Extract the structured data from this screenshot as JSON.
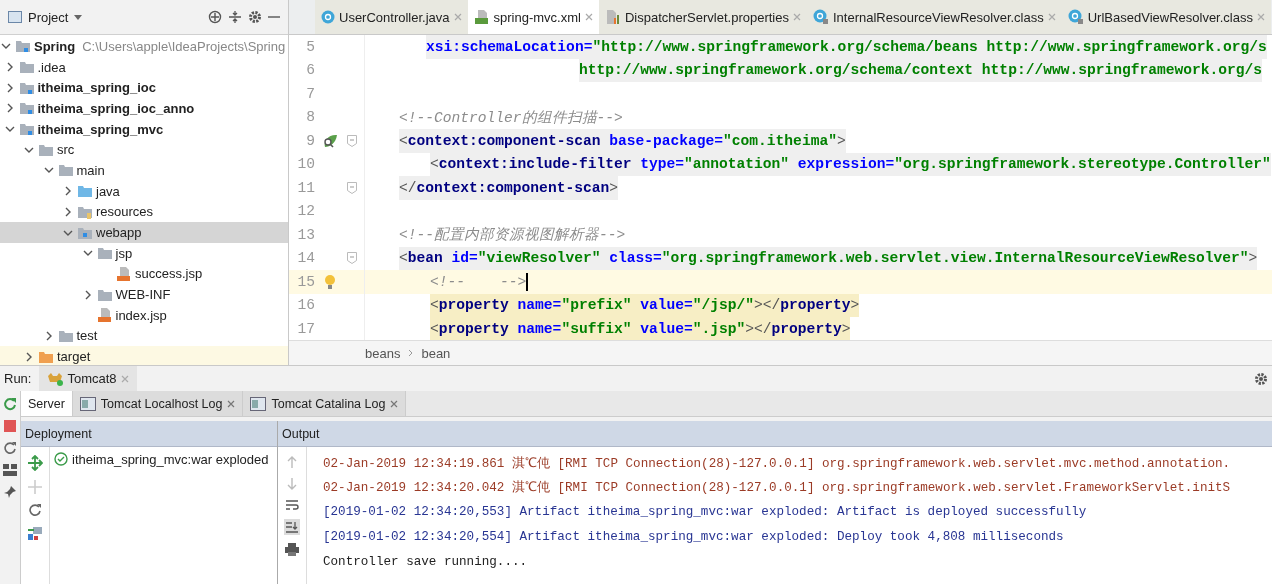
{
  "project_panel": {
    "title": "Project",
    "tree": [
      {
        "label": "Spring",
        "path": "C:\\Users\\apple\\IdeaProjects\\Spring",
        "kind": "module",
        "bold": true,
        "expanded": true,
        "selected": false,
        "children": [
          {
            "label": ".idea",
            "kind": "folder",
            "bold": false,
            "expanded": false,
            "selected": false
          },
          {
            "label": "itheima_spring_ioc",
            "kind": "module",
            "bold": true,
            "expanded": false,
            "selected": false
          },
          {
            "label": "itheima_spring_ioc_anno",
            "kind": "module",
            "bold": true,
            "expanded": false,
            "selected": false
          },
          {
            "label": "itheima_spring_mvc",
            "kind": "module",
            "bold": true,
            "expanded": true,
            "selected": false,
            "children": [
              {
                "label": "src",
                "kind": "folder",
                "bold": false,
                "expanded": true,
                "selected": false,
                "children": [
                  {
                    "label": "main",
                    "kind": "folder",
                    "bold": false,
                    "expanded": true,
                    "selected": false,
                    "children": [
                      {
                        "label": "java",
                        "kind": "source",
                        "bold": false,
                        "expanded": false,
                        "selected": false
                      },
                      {
                        "label": "resources",
                        "kind": "resources",
                        "bold": false,
                        "expanded": false,
                        "selected": false
                      },
                      {
                        "label": "webapp",
                        "kind": "web",
                        "bold": false,
                        "expanded": true,
                        "selected": true,
                        "children": [
                          {
                            "label": "jsp",
                            "kind": "folder",
                            "bold": false,
                            "expanded": true,
                            "selected": false,
                            "children": [
                              {
                                "label": "success.jsp",
                                "kind": "jsp",
                                "bold": false,
                                "selected": false
                              }
                            ]
                          },
                          {
                            "label": "WEB-INF",
                            "kind": "folder",
                            "bold": false,
                            "expanded": false,
                            "selected": false
                          },
                          {
                            "label": "index.jsp",
                            "kind": "jsp",
                            "bold": false,
                            "selected": false
                          }
                        ]
                      }
                    ]
                  },
                  {
                    "label": "test",
                    "kind": "folder",
                    "bold": false,
                    "expanded": false,
                    "selected": false
                  }
                ]
              },
              {
                "label": "target",
                "kind": "excluded",
                "bold": false,
                "expanded": false,
                "selected": false
              }
            ]
          }
        ]
      }
    ]
  },
  "editor": {
    "tabs": [
      {
        "label": "UserController.java",
        "kind": "java",
        "selected": false
      },
      {
        "label": "spring-mvc.xml",
        "kind": "xml",
        "selected": true
      },
      {
        "label": "DispatcherServlet.properties",
        "kind": "properties",
        "selected": false
      },
      {
        "label": "InternalResourceViewResolver.class",
        "kind": "class",
        "selected": false
      },
      {
        "label": "UrlBasedViewResolver.class",
        "kind": "class",
        "selected": false
      }
    ],
    "lines": [
      {
        "number": "5",
        "kind": "attribute",
        "highlighted": true,
        "matched": false,
        "current": false,
        "fold": false,
        "bean_icon": false,
        "bulb_icon": false,
        "tokens": [
          {
            "kind": "attr",
            "text": "xsi:schemaLocation="
          },
          {
            "kind": "value",
            "text": "\"http://www.springframework.org/schema/beans http://www.springframework.org/s"
          }
        ]
      },
      {
        "number": "6",
        "kind": "continuation",
        "highlighted": true,
        "matched": false,
        "current": false,
        "fold": false,
        "bean_icon": false,
        "bulb_icon": false,
        "tokens": [
          {
            "kind": "value",
            "text": "http://www.springframework.org/schema/context http://www.springframework.org/s"
          }
        ]
      },
      {
        "number": "7",
        "kind": "blank",
        "current": false,
        "fold": false,
        "bean_icon": false,
        "bulb_icon": false
      },
      {
        "number": "8",
        "kind": "element",
        "highlighted": false,
        "matched": false,
        "current": false,
        "fold": false,
        "bean_icon": false,
        "bulb_icon": false,
        "tokens": [
          {
            "kind": "comment",
            "text": "<!--Controller的组件扫描-->"
          }
        ]
      },
      {
        "number": "9",
        "kind": "element",
        "highlighted": true,
        "matched": false,
        "current": false,
        "fold": true,
        "bean_icon": true,
        "bulb_icon": false,
        "tokens": [
          {
            "kind": "bracket",
            "text": "<"
          },
          {
            "kind": "tag",
            "text": "context:component-scan "
          },
          {
            "kind": "attr",
            "text": "base-package="
          },
          {
            "kind": "value",
            "text": "\"com.itheima\""
          },
          {
            "kind": "bracket",
            "text": ">"
          }
        ]
      },
      {
        "number": "10",
        "kind": "child",
        "highlighted": true,
        "matched": false,
        "current": false,
        "fold": false,
        "bean_icon": false,
        "bulb_icon": false,
        "tokens": [
          {
            "kind": "bracket",
            "text": "<"
          },
          {
            "kind": "tag",
            "text": "context:include-filter "
          },
          {
            "kind": "attr",
            "text": "type="
          },
          {
            "kind": "value",
            "text": "\"annotation\" "
          },
          {
            "kind": "attr",
            "text": "expression="
          },
          {
            "kind": "value",
            "text": "\"org.springframework.stereotype.Controller\""
          }
        ]
      },
      {
        "number": "11",
        "kind": "element",
        "highlighted": true,
        "matched": false,
        "current": false,
        "fold": true,
        "bean_icon": false,
        "bulb_icon": false,
        "tokens": [
          {
            "kind": "bracket",
            "text": "</"
          },
          {
            "kind": "tag",
            "text": "context:component-scan"
          },
          {
            "kind": "bracket",
            "text": ">"
          }
        ]
      },
      {
        "number": "12",
        "kind": "blank",
        "current": false,
        "fold": false,
        "bean_icon": false,
        "bulb_icon": false
      },
      {
        "number": "13",
        "kind": "element",
        "highlighted": false,
        "matched": false,
        "current": false,
        "fold": false,
        "bean_icon": false,
        "bulb_icon": false,
        "tokens": [
          {
            "kind": "comment",
            "text": "<!--配置内部资源视图解析器-->"
          }
        ]
      },
      {
        "number": "14",
        "kind": "element",
        "highlighted": true,
        "matched": false,
        "current": false,
        "fold": true,
        "bean_icon": false,
        "bulb_icon": false,
        "tokens": [
          {
            "kind": "bracket",
            "text": "<"
          },
          {
            "kind": "tag",
            "text": "bean "
          },
          {
            "kind": "attr",
            "text": "id="
          },
          {
            "kind": "value",
            "text": "\"viewResolver\" "
          },
          {
            "kind": "attr",
            "text": "class="
          },
          {
            "kind": "value",
            "text": "\"org.springframework.web.servlet.view.InternalResourceViewResolver\""
          },
          {
            "kind": "bracket",
            "text": ">"
          }
        ]
      },
      {
        "number": "15",
        "kind": "child",
        "highlighted": false,
        "matched": false,
        "current": true,
        "fold": false,
        "bean_icon": false,
        "bulb_icon": true,
        "tokens": [
          {
            "kind": "comment",
            "text": "<!--    -->"
          }
        ]
      },
      {
        "number": "16",
        "kind": "child",
        "highlighted": false,
        "matched": true,
        "current": false,
        "fold": false,
        "bean_icon": false,
        "bulb_icon": false,
        "tokens": [
          {
            "kind": "bracket",
            "text": "<"
          },
          {
            "kind": "tag",
            "text": "property "
          },
          {
            "kind": "attr",
            "text": "name="
          },
          {
            "kind": "value",
            "text": "\"prefix\" "
          },
          {
            "kind": "attr",
            "text": "value="
          },
          {
            "kind": "value",
            "text": "\"/jsp/\""
          },
          {
            "kind": "bracket",
            "text": "></"
          },
          {
            "kind": "tag",
            "text": "property"
          },
          {
            "kind": "bracket",
            "text": ">"
          }
        ]
      },
      {
        "number": "17",
        "kind": "child",
        "highlighted": false,
        "matched": true,
        "current": false,
        "fold": false,
        "bean_icon": false,
        "bulb_icon": false,
        "tokens": [
          {
            "kind": "bracket",
            "text": "<"
          },
          {
            "kind": "tag",
            "text": "property "
          },
          {
            "kind": "attr",
            "text": "name="
          },
          {
            "kind": "value",
            "text": "\"suffix\" "
          },
          {
            "kind": "attr",
            "text": "value="
          },
          {
            "kind": "value",
            "text": "\".jsp\""
          },
          {
            "kind": "bracket",
            "text": "></"
          },
          {
            "kind": "tag",
            "text": "property"
          },
          {
            "kind": "bracket",
            "text": ">"
          }
        ]
      }
    ],
    "breadcrumbs": [
      "beans",
      "bean"
    ]
  },
  "run_panel": {
    "label": "Run:",
    "config_tab": "Tomcat8",
    "tabs": [
      {
        "label": "Server",
        "selected": true,
        "closable": false
      },
      {
        "label": "Tomcat Localhost Log",
        "selected": false,
        "closable": true
      },
      {
        "label": "Tomcat Catalina Log",
        "selected": false,
        "closable": true
      }
    ],
    "deployment": {
      "header": "Deployment",
      "items": [
        "itheima_spring_mvc:war exploded"
      ]
    },
    "output": {
      "header": "Output",
      "lines": [
        {
          "kind": "log",
          "text": "02-Jan-2019 12:34:19.861 淇℃伅 [RMI TCP Connection(28)-127.0.0.1] org.springframework.web.servlet.mvc.method.annotation."
        },
        {
          "kind": "log",
          "text": "02-Jan-2019 12:34:20.042 淇℃伅 [RMI TCP Connection(28)-127.0.0.1] org.springframework.web.servlet.FrameworkServlet.initS"
        },
        {
          "kind": "system",
          "text": "[2019-01-02 12:34:20,553] Artifact itheima_spring_mvc:war exploded: Artifact is deployed successfully"
        },
        {
          "kind": "system",
          "text": "[2019-01-02 12:34:20,554] Artifact itheima_spring_mvc:war exploded: Deploy took 4,808 milliseconds"
        },
        {
          "kind": "stdout",
          "text": "Controller save running...."
        }
      ]
    }
  }
}
